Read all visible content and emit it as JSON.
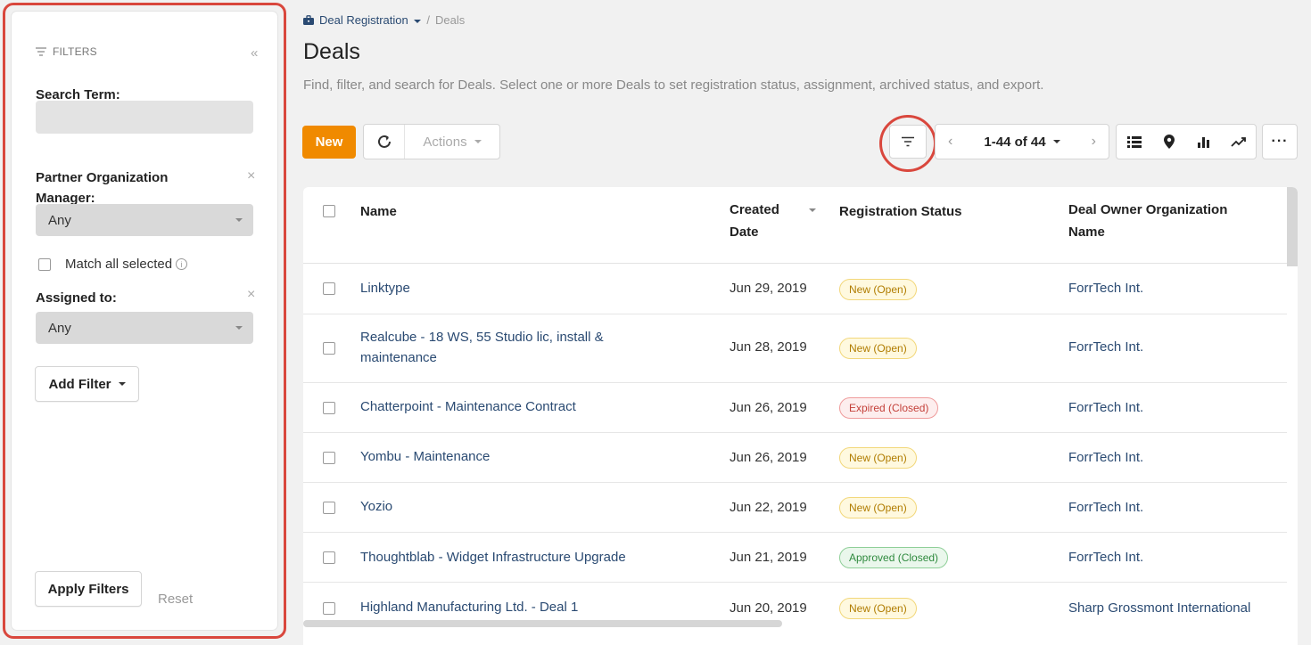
{
  "filters": {
    "title": "FILTERS",
    "collapse_glyph": "«",
    "search_label": "Search Term:",
    "search_value": "",
    "partner_label_line1": "Partner Organization",
    "partner_label_line2": "Manager:",
    "partner_value": "Any",
    "match_all_label": "Match all selected",
    "assigned_label": "Assigned to:",
    "assigned_value": "Any",
    "add_filter_label": "Add Filter",
    "apply_label": "Apply Filters",
    "reset_label": "Reset",
    "remove_glyph": "×"
  },
  "breadcrumb": {
    "section": "Deal Registration",
    "separator": "/",
    "current": "Deals"
  },
  "page": {
    "title": "Deals",
    "description": "Find, filter, and search for Deals. Select one or more Deals to set registration status, assignment, archived status, and export."
  },
  "toolbar": {
    "new_label": "New",
    "actions_label": "Actions",
    "pager_text": "1-44 of 44",
    "prev": "‹",
    "next": "›",
    "more": "···"
  },
  "table": {
    "headers": {
      "name": "Name",
      "created_line1": "Created",
      "created_line2": "Date",
      "status": "Registration Status",
      "org_line1": "Deal Owner Organization",
      "org_line2": "Name"
    },
    "rows": [
      {
        "name": "Linktype",
        "date": "Jun 29, 2019",
        "status": "New (Open)",
        "org": "ForrTech Int."
      },
      {
        "name": "Realcube - 18 WS, 55 Studio lic, install & maintenance",
        "date": "Jun 28, 2019",
        "status": "New (Open)",
        "org": "ForrTech Int."
      },
      {
        "name": "Chatterpoint - Maintenance Contract",
        "date": "Jun 26, 2019",
        "status": "Expired (Closed)",
        "org": "ForrTech Int."
      },
      {
        "name": "Yombu - Maintenance",
        "date": "Jun 26, 2019",
        "status": "New (Open)",
        "org": "ForrTech Int."
      },
      {
        "name": "Yozio",
        "date": "Jun 22, 2019",
        "status": "New (Open)",
        "org": "ForrTech Int."
      },
      {
        "name": "Thoughtblab - Widget Infrastructure Upgrade",
        "date": "Jun 21, 2019",
        "status": "Approved (Closed)",
        "org": "ForrTech Int."
      },
      {
        "name": "Highland Manufacturing Ltd. - Deal 1",
        "date": "Jun 20, 2019",
        "status": "New (Open)",
        "org": "Sharp Grossmont International"
      }
    ]
  },
  "colors": {
    "accent": "#f08a00",
    "link": "#2a4a72",
    "highlight": "#d9473d"
  }
}
